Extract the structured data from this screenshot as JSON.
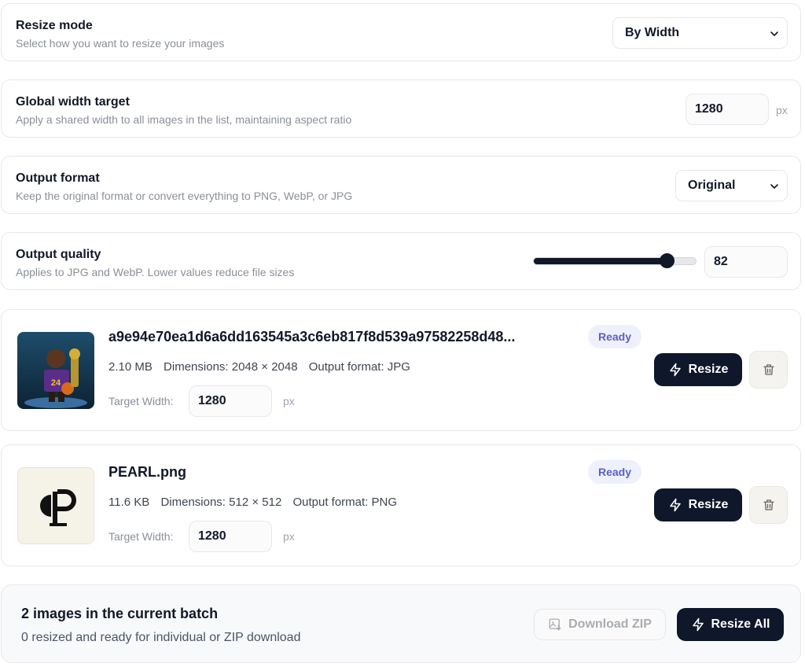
{
  "settings": {
    "resize_mode": {
      "title": "Resize mode",
      "description": "Select how you want to resize your images",
      "value": "By Width"
    },
    "global_width": {
      "title": "Global width target",
      "description": "Apply a shared width to all images in the list, maintaining aspect ratio",
      "value": "1280",
      "unit": "px"
    },
    "output_format": {
      "title": "Output format",
      "description": "Keep the original format or convert everything to PNG, WebP, or JPG",
      "value": "Original"
    },
    "output_quality": {
      "title": "Output quality",
      "description": "Applies to JPG and WebP. Lower values reduce file sizes",
      "value": "82",
      "slider_fraction": 0.82
    }
  },
  "files": [
    {
      "name": "a9e94e70ea1d6a6dd163545a3c6eb817f8d539a97582258d48...",
      "size": "2.10 MB",
      "dimensions": "Dimensions: 2048 × 2048",
      "format": "Output format: JPG",
      "status": "Ready",
      "target_label": "Target Width:",
      "target_value": "1280",
      "target_unit": "px",
      "resize_label": "Resize"
    },
    {
      "name": "PEARL.png",
      "size": "11.6 KB",
      "dimensions": "Dimensions: 512 × 512",
      "format": "Output format: PNG",
      "status": "Ready",
      "target_label": "Target Width:",
      "target_value": "1280",
      "target_unit": "px",
      "resize_label": "Resize"
    }
  ],
  "footer": {
    "title": "2 images in the current batch",
    "subtitle": "0 resized and ready for individual or ZIP download",
    "download_label": "Download ZIP",
    "resize_all_label": "Resize All"
  },
  "colors": {
    "primary": "#0f172a",
    "badge_bg": "#eef0fb",
    "badge_text": "#5b5fc7"
  },
  "icons": [
    "chevron-down-icon",
    "bolt-icon",
    "trash-icon",
    "image-download-icon"
  ]
}
